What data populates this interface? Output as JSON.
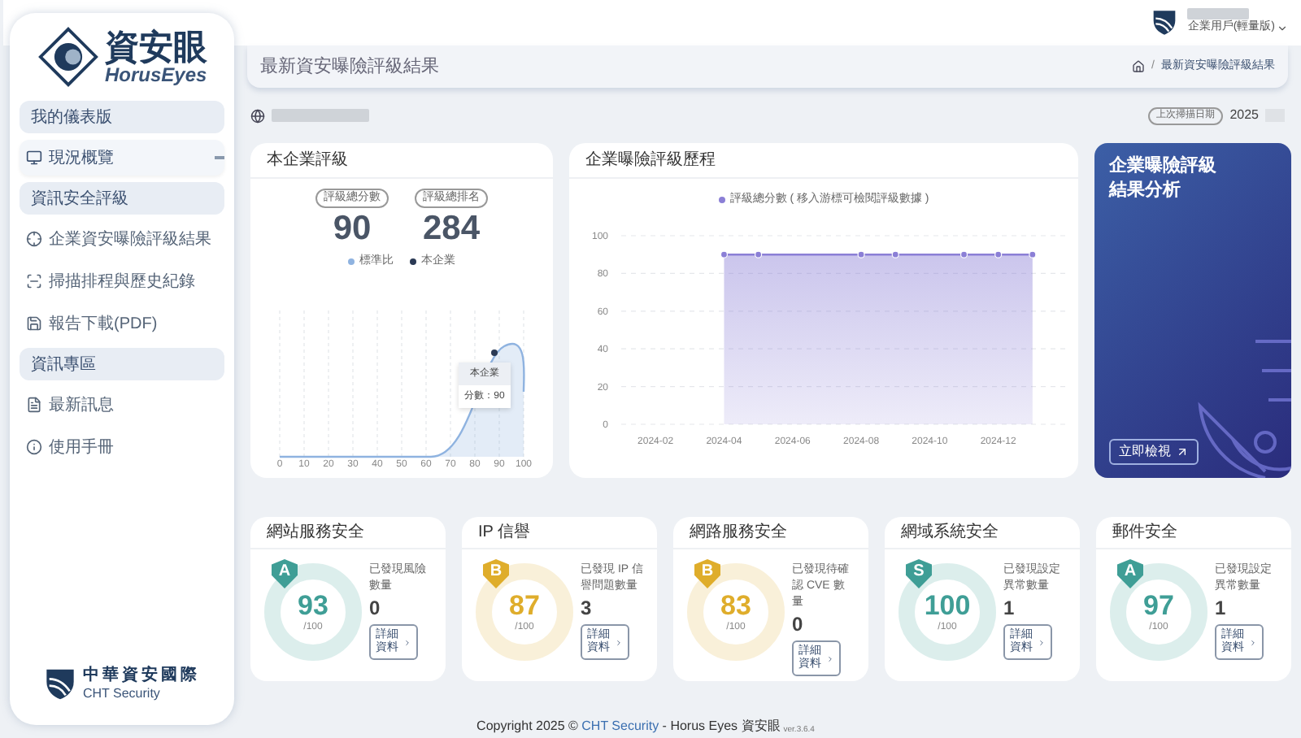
{
  "sidebar": {
    "logo": {
      "name": "資安眼",
      "subname": "HorusEyes"
    },
    "items": [
      {
        "kind": "group",
        "label": "我的儀表版"
      },
      {
        "kind": "item",
        "label": "現況概覽",
        "selected": true
      },
      {
        "kind": "group",
        "label": "資訊安全評級"
      },
      {
        "kind": "item",
        "label": "企業資安曝險評級結果",
        "selected": false
      },
      {
        "kind": "item",
        "label": "掃描排程與歷史紀錄",
        "selected": false
      },
      {
        "kind": "item",
        "label": "報告下載(PDF)",
        "selected": false
      },
      {
        "kind": "group",
        "label": "資訊專區"
      },
      {
        "kind": "item",
        "label": "最新訊息",
        "selected": false
      },
      {
        "kind": "item",
        "label": "使用手冊",
        "selected": false
      }
    ],
    "footer_logo": {
      "name": "中華資安國際",
      "subname": "CHT Security"
    }
  },
  "top_bar": {
    "user_role": "企業用戶(輕量版)"
  },
  "header": {
    "title": "最新資安曝險評級結果",
    "breadcrumb_separator": "/",
    "breadcrumb": "最新資安曝險評級結果"
  },
  "domain_row": {
    "last_scan_label": "上次掃描日期",
    "last_scan_date": "2025"
  },
  "rating_card": {
    "title": "本企業評級",
    "stats": [
      {
        "label": "評級總分數",
        "value": "90"
      },
      {
        "label": "評級總排名",
        "value": "284"
      }
    ],
    "legend": [
      {
        "label": "標準比",
        "color": "#8fb3e0"
      },
      {
        "label": "本企業",
        "color": "#2b3a55"
      }
    ],
    "x_axis_labels": [
      "0",
      "10",
      "20",
      "30",
      "40",
      "50",
      "60",
      "70",
      "80",
      "90",
      "100"
    ],
    "tooltip": {
      "title": "本企業",
      "text": "分數：90"
    }
  },
  "history_card": {
    "title": "企業曝險評級歷程",
    "chart_data": {
      "type": "area",
      "series": [
        {
          "name": "評級總分數 ( 移入游標可檢閱評級數據 )",
          "color": "#8b7fd6",
          "values": [
            90,
            90,
            90,
            90,
            90,
            90,
            90
          ]
        }
      ],
      "x": [
        "2024-04",
        "2024-05",
        "2024-08",
        "2024-09",
        "2024-11",
        "2024-12",
        "2025-01"
      ],
      "xticks": [
        "2024-02",
        "2024-04",
        "2024-06",
        "2024-08",
        "2024-10",
        "2024-12"
      ],
      "yticks": [
        0,
        20,
        40,
        60,
        80,
        100
      ],
      "xlim": [
        "2024-01",
        "2025-02"
      ],
      "ylim": [
        0,
        100
      ],
      "grid": true
    }
  },
  "promo_card": {
    "title_lines": [
      "企業曝險評級",
      "結果分析"
    ],
    "button": "立即檢視"
  },
  "score_cards": [
    {
      "title": "網站服務安全",
      "grade": "A",
      "color": "#3f9e96",
      "score": "93",
      "max": "/100",
      "description": "已發現風險數量",
      "count": "0",
      "button": "詳細資料"
    },
    {
      "title": "IP 信譽",
      "grade": "B",
      "color": "#dfad2b",
      "score": "87",
      "max": "/100",
      "description": "已發現 IP 信譽問題數量",
      "count": "3",
      "button": "詳細資料"
    },
    {
      "title": "網路服務安全",
      "grade": "B",
      "color": "#dfad2b",
      "score": "83",
      "max": "/100",
      "description": "已發現待確認 CVE 數量",
      "count": "0",
      "button": "詳細資料"
    },
    {
      "title": "網域系統安全",
      "grade": "S",
      "color": "#3f9e96",
      "score": "100",
      "max": "/100",
      "description": "已發現設定異常數量",
      "count": "1",
      "button": "詳細資料"
    },
    {
      "title": "郵件安全",
      "grade": "A",
      "color": "#3f9e96",
      "score": "97",
      "max": "/100",
      "description": "已發現設定異常數量",
      "count": "1",
      "button": "詳細資料"
    }
  ],
  "footer": {
    "text_before": "Copyright 2025 © ",
    "link": "CHT Security",
    "text_after": " - Horus Eyes 資安眼",
    "version": "ver.3.6.4"
  }
}
